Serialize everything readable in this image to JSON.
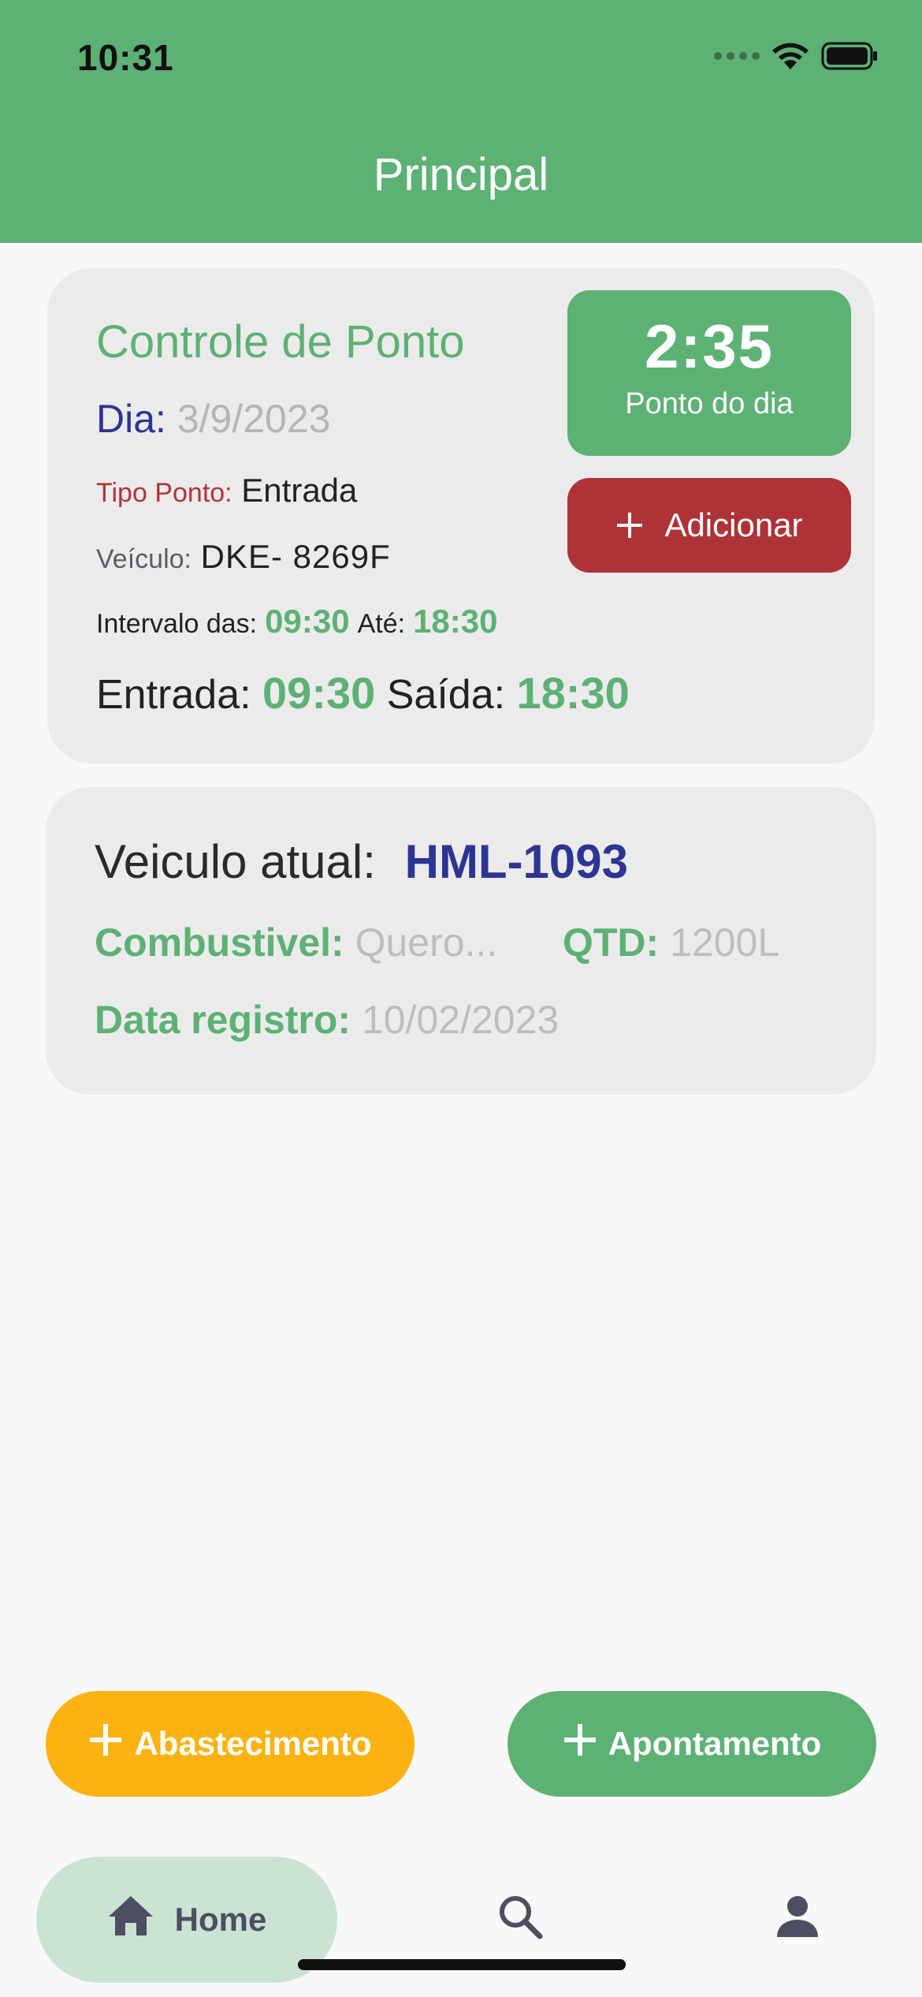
{
  "status_bar": {
    "time": "10:31"
  },
  "header": {
    "title": "Principal"
  },
  "controle_ponto": {
    "title": "Controle de Ponto",
    "dia_label": "Dia:",
    "dia_value": "3/9/2023",
    "tipo_label": "Tipo Ponto:",
    "tipo_value": "Entrada",
    "veiculo_label": "Veículo:",
    "veiculo_value": "DKE- 8269F",
    "intervalo_label": "Intervalo das:",
    "intervalo_inicio": "09:30",
    "ate_label": "Até:",
    "intervalo_fim": "18:30",
    "entrada_label": "Entrada:",
    "entrada_value": "09:30",
    "saida_label": "Saída:",
    "saida_value": "18:30",
    "ponto_time": "2:35",
    "ponto_label": "Ponto do dia",
    "add_label": "Adicionar"
  },
  "veiculo_atual": {
    "label": "Veiculo atual:",
    "value": "HML-1093",
    "combustivel_label": "Combustivel:",
    "combustivel_value": "Quero...",
    "qtd_label": "QTD:",
    "qtd_value": "1200L",
    "data_label": "Data registro:",
    "data_value": "10/02/2023"
  },
  "actions": {
    "abastecimento_label": "Abastecimento",
    "apontamento_label": "Apontamento"
  },
  "bottom_nav": {
    "home_label": "Home",
    "icons": [
      "home-icon",
      "search-icon",
      "profile-icon"
    ]
  },
  "colors": {
    "primary_green": "#5db174",
    "accent_red": "#ad3338",
    "accent_yellow": "#fcb212",
    "accent_blue": "#2d3592",
    "nav_active_bg": "#cbe3d3"
  }
}
